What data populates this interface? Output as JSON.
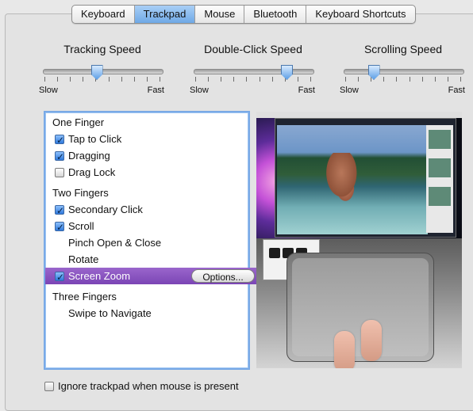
{
  "tabs": [
    {
      "label": "Keyboard",
      "active": false
    },
    {
      "label": "Trackpad",
      "active": true
    },
    {
      "label": "Mouse",
      "active": false
    },
    {
      "label": "Bluetooth",
      "active": false
    },
    {
      "label": "Keyboard Shortcuts",
      "active": false
    }
  ],
  "sliders": [
    {
      "title": "Tracking Speed",
      "min_label": "Slow",
      "max_label": "Fast",
      "value_fraction": 0.45
    },
    {
      "title": "Double-Click Speed",
      "min_label": "Slow",
      "max_label": "Fast",
      "value_fraction": 0.78
    },
    {
      "title": "Scrolling Speed",
      "min_label": "Slow",
      "max_label": "Fast",
      "value_fraction": 0.25
    }
  ],
  "gesture_list": {
    "sections": [
      {
        "title": "One Finger",
        "items": [
          {
            "label": "Tap to Click",
            "checked": true,
            "has_checkbox": true
          },
          {
            "label": "Dragging",
            "checked": true,
            "has_checkbox": true
          },
          {
            "label": "Drag Lock",
            "checked": false,
            "has_checkbox": true
          }
        ]
      },
      {
        "title": "Two Fingers",
        "items": [
          {
            "label": "Secondary Click",
            "checked": true,
            "has_checkbox": true
          },
          {
            "label": "Scroll",
            "checked": true,
            "has_checkbox": true
          },
          {
            "label": "Pinch Open & Close",
            "checked": false,
            "has_checkbox": false
          },
          {
            "label": "Rotate",
            "checked": false,
            "has_checkbox": false
          },
          {
            "label": "Screen Zoom",
            "checked": true,
            "has_checkbox": true,
            "selected": true,
            "button_label": "Options..."
          }
        ]
      },
      {
        "title": "Three Fingers",
        "items": [
          {
            "label": "Swipe to Navigate",
            "checked": false,
            "has_checkbox": false
          }
        ]
      }
    ]
  },
  "ignore_trackpad": {
    "label": "Ignore trackpad when mouse is present",
    "checked": false
  },
  "colors": {
    "selection": "#8e56c2",
    "accent_blue": "#4f8fe0"
  }
}
